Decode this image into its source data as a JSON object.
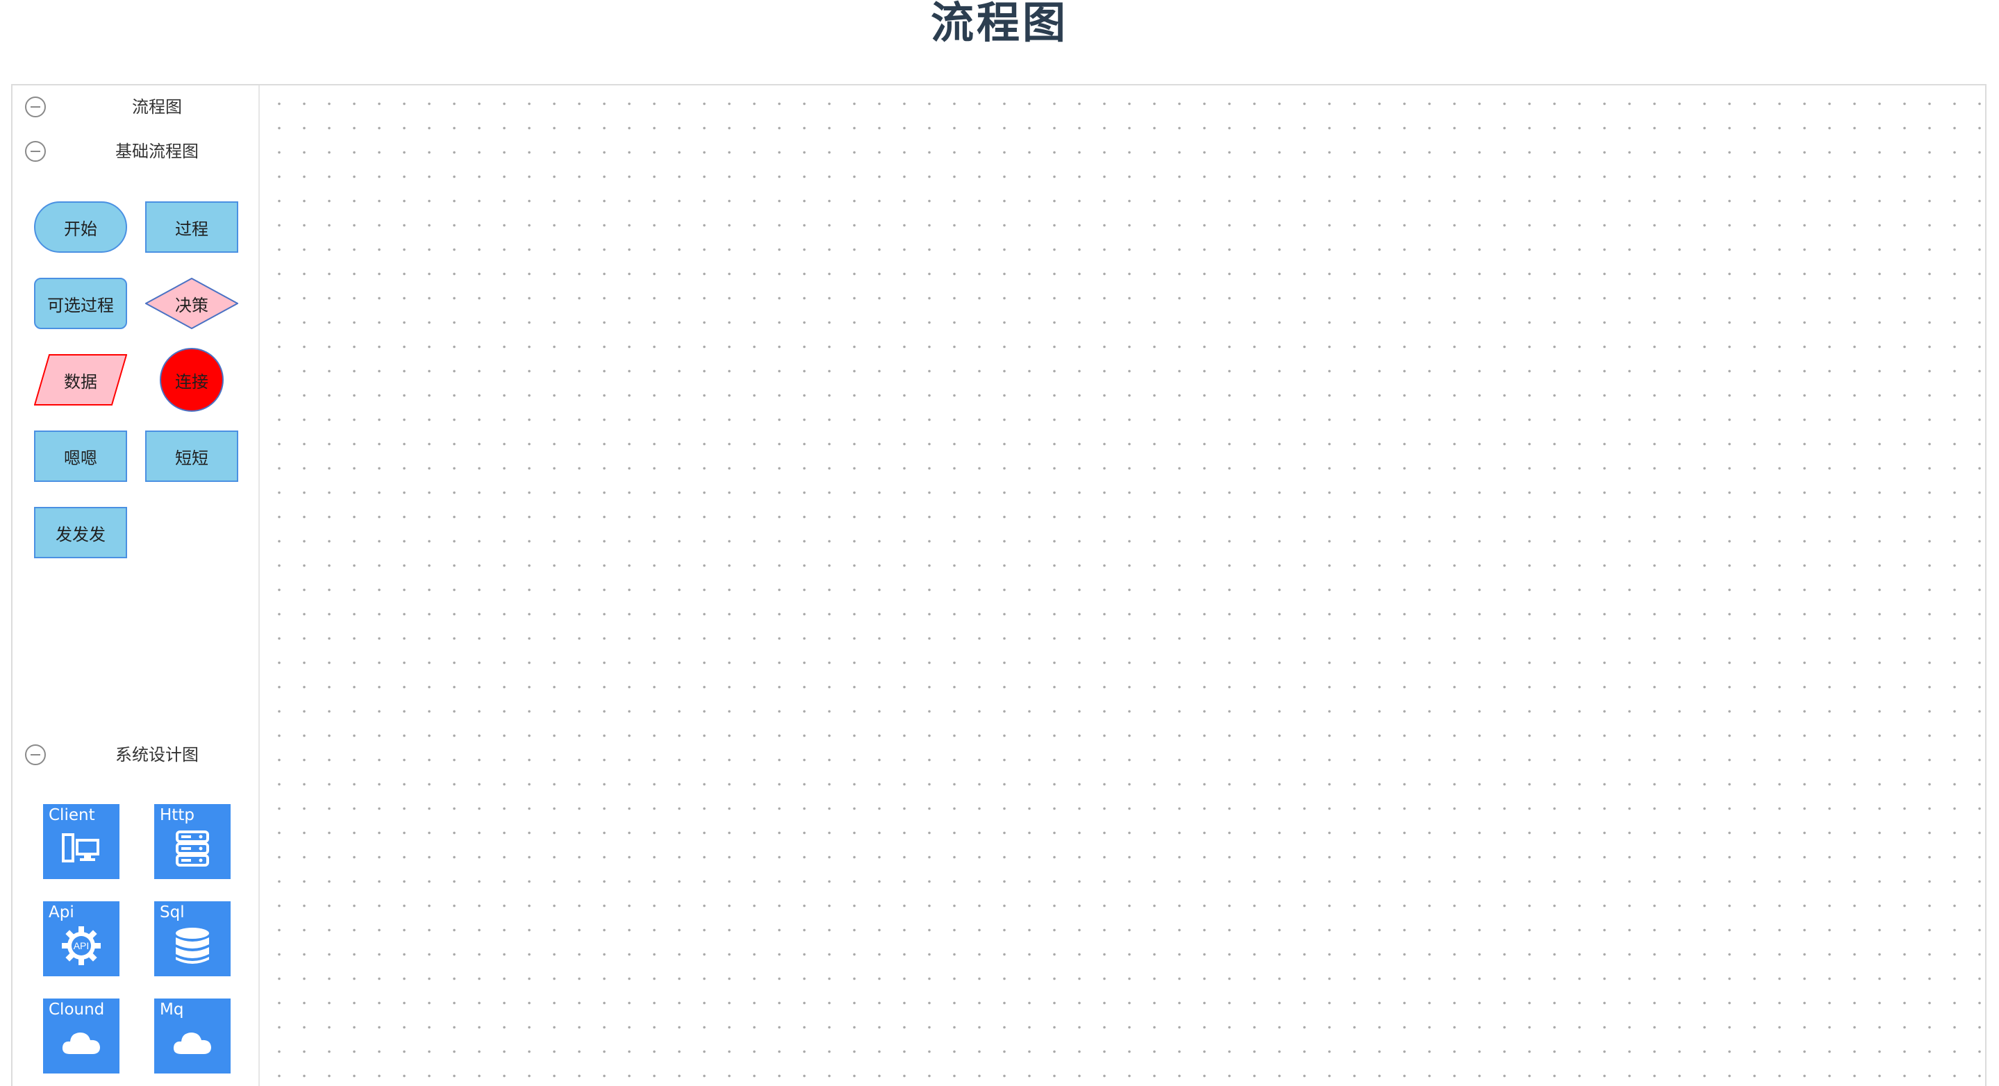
{
  "page": {
    "title": "流程图"
  },
  "sidebar": {
    "groups": [
      {
        "title": "流程图",
        "collapse_icon": "minus-circle-icon"
      },
      {
        "title": "基础流程图",
        "collapse_icon": "minus-circle-icon",
        "shapes": [
          {
            "label": "开始",
            "kind": "terminator",
            "fill": "#87ceeb",
            "stroke": "#4a90e2"
          },
          {
            "label": "过程",
            "kind": "process",
            "fill": "#87ceeb",
            "stroke": "#4a90e2"
          },
          {
            "label": "可选过程",
            "kind": "alternate-process",
            "fill": "#87ceeb",
            "stroke": "#4a90e2"
          },
          {
            "label": "决策",
            "kind": "decision",
            "fill": "#ffc0cb",
            "stroke": "#4a72c4"
          },
          {
            "label": "数据",
            "kind": "data",
            "fill": "#ffc0cb",
            "stroke": "#ff0000"
          },
          {
            "label": "连接",
            "kind": "connector",
            "fill": "#ff0000",
            "stroke": "#4a72c4"
          },
          {
            "label": "嗯嗯",
            "kind": "process",
            "fill": "#87ceeb",
            "stroke": "#4a90e2"
          },
          {
            "label": "短短",
            "kind": "process",
            "fill": "#87ceeb",
            "stroke": "#4a90e2"
          },
          {
            "label": "发发发",
            "kind": "process",
            "fill": "#87ceeb",
            "stroke": "#4a90e2"
          }
        ]
      },
      {
        "title": "系统设计图",
        "collapse_icon": "minus-circle-icon",
        "tiles": [
          {
            "label": "Client",
            "icon": "client-device-icon"
          },
          {
            "label": "Http",
            "icon": "server-icon"
          },
          {
            "label": "Api",
            "icon": "api-gear-icon",
            "icon_text": "API"
          },
          {
            "label": "Sql",
            "icon": "database-icon"
          },
          {
            "label": "Clound",
            "icon": "cloud-icon"
          },
          {
            "label": "Mq",
            "icon": "cloud-icon"
          }
        ],
        "tile_color": "#3d8ef0"
      }
    ]
  },
  "canvas": {
    "grid": "dotted",
    "grid_color": "#a9a9a9",
    "background": "#ffffff"
  }
}
